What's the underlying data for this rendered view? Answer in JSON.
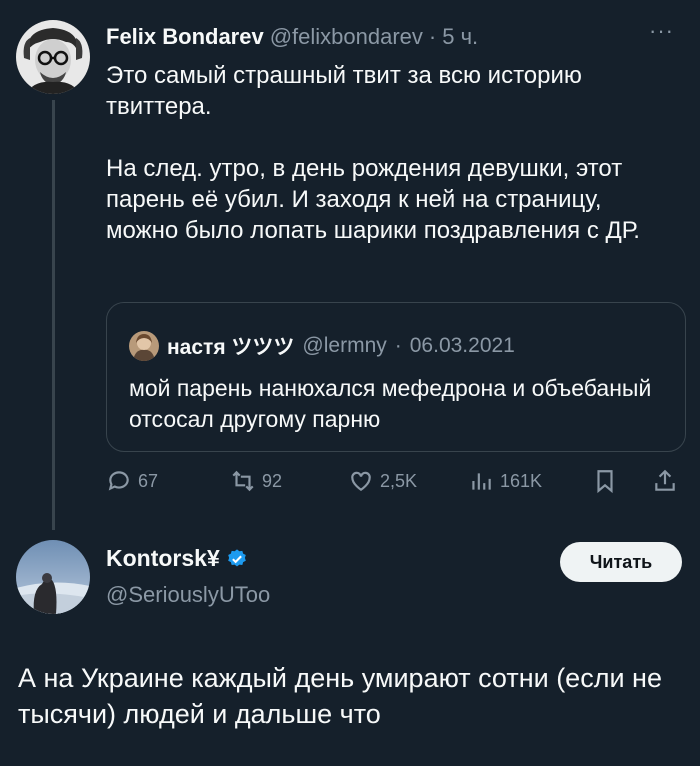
{
  "tweet1": {
    "name": "Felix Bondarev",
    "handle": "@felixbondarev",
    "dot": "·",
    "time": "5 ч.",
    "more": "···",
    "text_lines": [
      "Это самый страшный твит за всю историю твиттера.",
      "",
      "На след. утро, в день рождения девушки, этот парень её убил. И заходя к ней на страницу, можно было лопать шарики поздравления с ДР."
    ],
    "quote": {
      "name": "настя ツツツ",
      "handle": "@lermny",
      "dot": "·",
      "date": "06.03.2021",
      "text": "мой парень нанюхался мефедрона и объебаный отсосал другому парню"
    },
    "actions": {
      "replies": "67",
      "retweets": "92",
      "likes": "2,5K",
      "views": "161K"
    }
  },
  "tweet2": {
    "name": "Kontorsk¥",
    "handle": "@SeriouslyUToo",
    "follow_label": "Читать",
    "text": "А на Украине каждый день умирают сотни (если не тысячи) людей и дальше что"
  },
  "colors": {
    "background": "#15202b",
    "muted": "#8b98a5",
    "verified": "#1d9bf0"
  }
}
